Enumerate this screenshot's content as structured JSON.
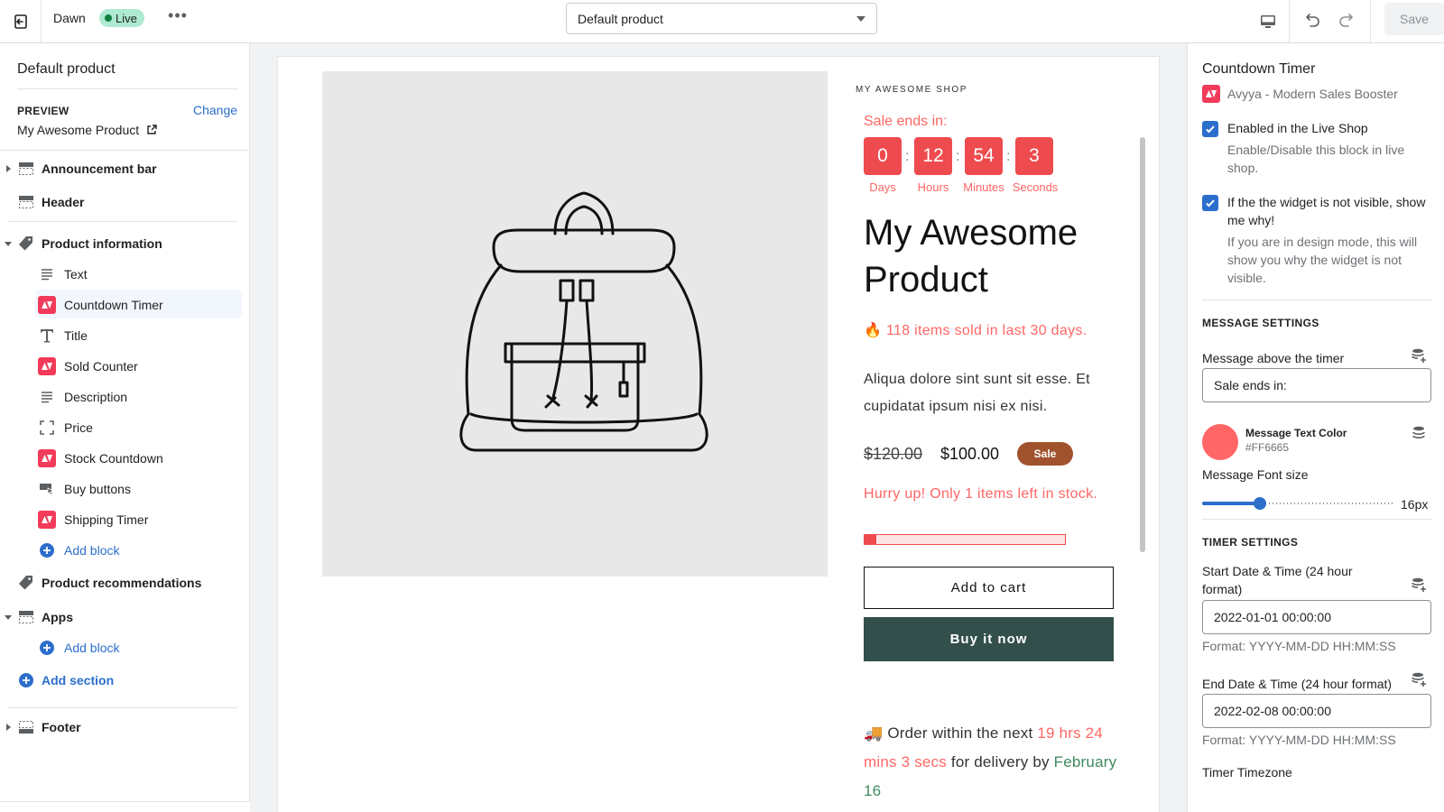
{
  "topbar": {
    "theme_name": "Dawn",
    "live_label": "Live",
    "more_label": "•••",
    "template_select": "Default product",
    "save_label": "Save"
  },
  "sidebar": {
    "title": "Default product",
    "preview_label": "PREVIEW",
    "change_label": "Change",
    "preview_product": "My Awesome Product",
    "sections": {
      "announcement": "Announcement bar",
      "header": "Header",
      "product_information": "Product information",
      "blocks": [
        {
          "label": "Text",
          "icon": "text-lines-icon"
        },
        {
          "label": "Countdown Timer",
          "icon": "avyya-app-icon"
        },
        {
          "label": "Title",
          "icon": "title-t-icon"
        },
        {
          "label": "Sold Counter",
          "icon": "avyya-app-icon"
        },
        {
          "label": "Description",
          "icon": "text-lines-icon"
        },
        {
          "label": "Price",
          "icon": "price-frame-icon"
        },
        {
          "label": "Stock Countdown",
          "icon": "avyya-app-icon"
        },
        {
          "label": "Buy buttons",
          "icon": "buy-buttons-icon"
        },
        {
          "label": "Shipping Timer",
          "icon": "avyya-app-icon"
        }
      ],
      "add_block": "Add block",
      "product_recommendations": "Product recommendations",
      "apps": "Apps",
      "apps_add_block": "Add block",
      "add_section": "Add section",
      "footer": "Footer"
    }
  },
  "preview": {
    "shop_name": "MY AWESOME SHOP",
    "sale_ends_label": "Sale ends in:",
    "countdown": [
      {
        "value": "0",
        "label": "Days"
      },
      {
        "value": "12",
        "label": "Hours"
      },
      {
        "value": "54",
        "label": "Minutes"
      },
      {
        "value": "3",
        "label": "Seconds"
      }
    ],
    "colon": ":",
    "product_title": "My Awesome Product",
    "sold_text": "🔥 118 items sold in last 30 days.",
    "description": "Aliqua dolore sint sunt sit esse. Et cupidatat ipsum nisi ex nisi.",
    "price_old": "$120.00",
    "price_new": "$100.00",
    "sale_badge": "Sale",
    "hurry_text": "Hurry up! Only 1 items left in stock.",
    "stock_level_pct": 6,
    "add_to_cart": "Add to cart",
    "buy_now": "Buy it now",
    "shipping": {
      "emoji": "🚚",
      "prefix": "Order within the next",
      "time": "19 hrs 24 mins 3 secs",
      "middle": "for delivery by",
      "date": "February 16"
    }
  },
  "settings": {
    "title": "Countdown Timer",
    "app_name": "Avyya - Modern Sales Booster",
    "enabled_label": "Enabled in the Live Shop",
    "enabled_help": "Enable/Disable this block in live shop.",
    "debug_label": "If the the widget is not visible, show me why!",
    "debug_help": "If you are in design mode, this will show you why the widget is not visible.",
    "message_heading": "MESSAGE SETTINGS",
    "message_above_label": "Message above the timer",
    "message_above_value": "Sale ends in:",
    "text_color_label": "Message Text Color",
    "text_color_value": "#FF6665",
    "font_size_label": "Message Font size",
    "font_size_value": "16px",
    "font_size_fraction": 0.3,
    "timer_heading": "TIMER SETTINGS",
    "start_label": "Start Date & Time (24 hour format)",
    "start_value": "2022-01-01 00:00:00",
    "start_help": "Format: YYYY-MM-DD HH:MM:SS",
    "end_label": "End Date & Time (24 hour format)",
    "end_value": "2022-02-08 00:00:00",
    "end_help": "Format: YYYY-MM-DD HH:MM:SS",
    "timezone_label": "Timer Timezone"
  },
  "colors": {
    "accent_blue": "#2C6ECB",
    "timer_red": "#EE4B4F",
    "message_red": "#FF6665",
    "buy_now_bg": "#334F4B",
    "sale_badge_bg": "#A0522D"
  }
}
